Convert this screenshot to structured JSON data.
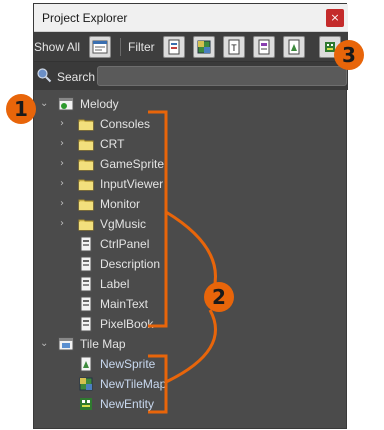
{
  "window": {
    "title": "Project Explorer",
    "close_glyph": "×"
  },
  "toolbar": {
    "show_all_label": "Show All",
    "filter_label": "Filter",
    "filter_buttons": [
      "ctrlpanel-filter",
      "tilemap-filter",
      "text-filter",
      "label-filter",
      "sprite-filter",
      "entity-filter"
    ]
  },
  "search": {
    "label": "Search",
    "value": ""
  },
  "tree": {
    "melody": {
      "label": "Melody",
      "folders": [
        "Consoles",
        "CRT",
        "GameSprite",
        "InputViewer",
        "Monitor",
        "VgMusic"
      ],
      "items": [
        "CtrlPanel",
        "Description",
        "Label",
        "MainText",
        "PixelBook"
      ]
    },
    "tilemap": {
      "label": "Tile Map",
      "items": [
        "NewSprite",
        "NewTileMap",
        "NewEntity"
      ]
    }
  },
  "annotations": {
    "one": "1",
    "two": "2",
    "three": "3",
    "accent_color": "#e8650a"
  }
}
